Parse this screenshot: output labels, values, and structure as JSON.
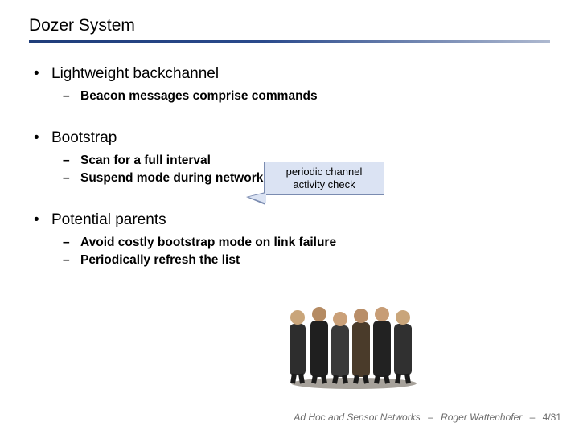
{
  "title": "Dozer System",
  "bullets": [
    {
      "label": "Lightweight backchannel",
      "subs": [
        "Beacon messages comprise commands"
      ]
    },
    {
      "label": "Bootstrap",
      "subs": [
        "Scan for a full interval",
        "Suspend mode during network downtime"
      ]
    },
    {
      "label": "Potential parents",
      "subs": [
        "Avoid costly bootstrap mode on link failure",
        "Periodically refresh the list"
      ]
    }
  ],
  "callout": {
    "line1": "periodic channel",
    "line2": "activity check"
  },
  "footer": {
    "course": "Ad Hoc and Sensor Networks",
    "author": "Roger Wattenhofer",
    "page": "4/31"
  }
}
